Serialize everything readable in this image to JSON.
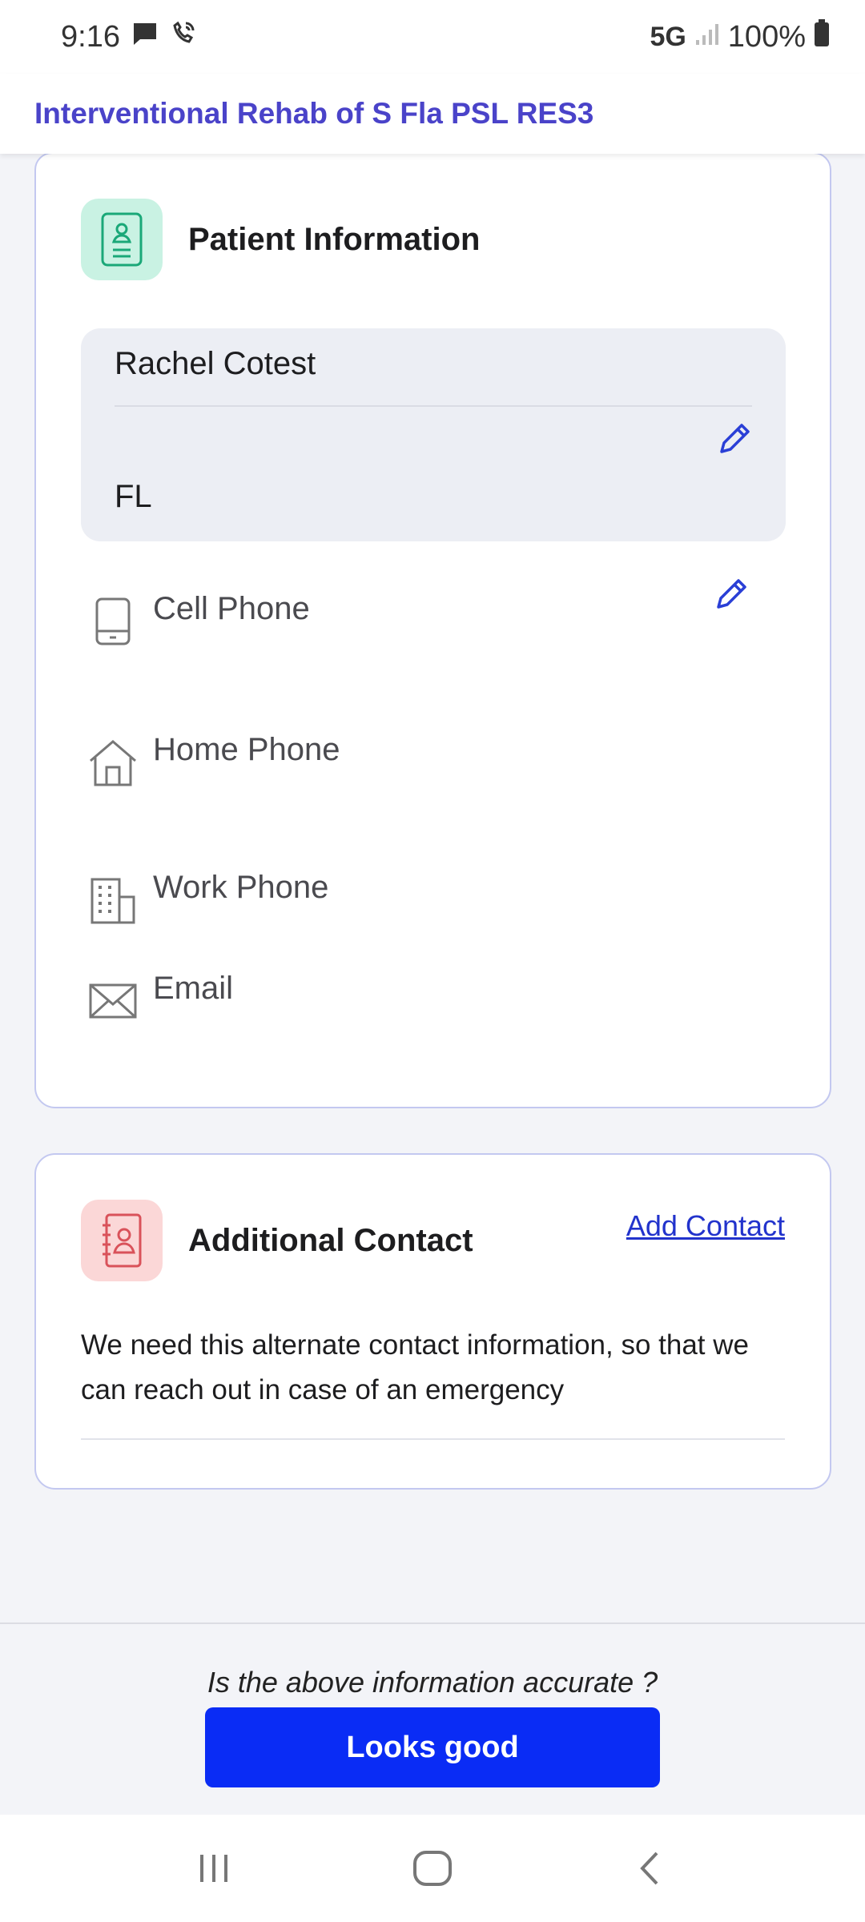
{
  "status_bar": {
    "time": "9:16",
    "network": "5G",
    "battery": "100%"
  },
  "header": {
    "title": "Interventional Rehab of S Fla PSL RES3"
  },
  "patient_card": {
    "title": "Patient Information",
    "name": "Rachel Cotest",
    "state": "FL",
    "contacts": {
      "cell_phone_label": "Cell Phone",
      "home_phone_label": "Home Phone",
      "work_phone_label": "Work Phone",
      "email_label": "Email"
    }
  },
  "additional_card": {
    "title": "Additional Contact",
    "add_contact_label": "Add Contact",
    "description": "We need this alternate contact information, so that we can reach out in case of an emergency"
  },
  "footer": {
    "question": "Is the above information accurate ?",
    "confirm_label": "Looks good"
  },
  "colors": {
    "header_title": "#4a43c9",
    "primary_button": "#0a2cf5",
    "link": "#2233cc",
    "patient_icon_bg": "#c9f2e3",
    "contact_icon_bg": "#fbd7d7"
  }
}
